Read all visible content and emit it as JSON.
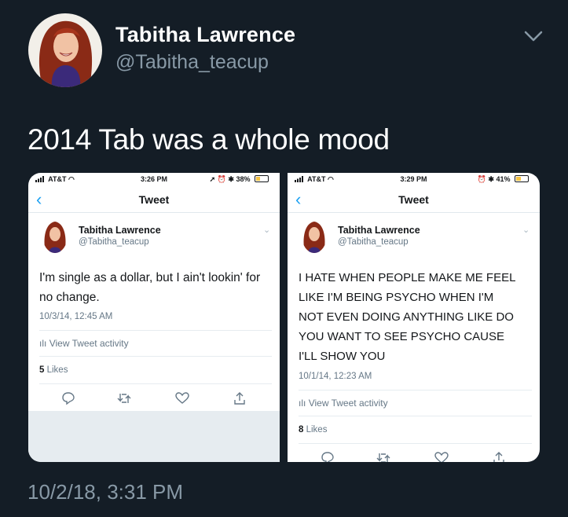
{
  "tweet": {
    "author_name": "Tabitha Lawrence",
    "author_handle": "@Tabitha_teacup",
    "text": "2014 Tab was a whole mood",
    "timestamp": "10/2/18, 3:31 PM",
    "menu_icon": "chevron-down-icon"
  },
  "screenshots": {
    "left": {
      "carrier": "AT&T",
      "time": "3:26 PM",
      "status_right": "38%",
      "battery_level": 0.38,
      "nav_title": "Tweet",
      "author_name": "Tabitha Lawrence",
      "author_handle": "@Tabitha_teacup",
      "text_line1": "I'm single as a dollar, but I ain't lookin' for",
      "text_line2": "no change.",
      "date": "10/3/14, 12:45 AM",
      "activity": "View Tweet activity",
      "likes_count": "5",
      "likes_label": "Likes"
    },
    "right": {
      "carrier": "AT&T",
      "time": "3:29 PM",
      "status_right": "41%",
      "battery_level": 0.41,
      "nav_title": "Tweet",
      "author_name": "Tabitha Lawrence",
      "author_handle": "@Tabitha_teacup",
      "text_line1": "I HATE WHEN PEOPLE MAKE ME FEEL",
      "text_line2": "LIKE I'M BEING PSYCHO WHEN I'M",
      "text_line3": "NOT EVEN DOING ANYTHING LIKE DO",
      "text_line4": "YOU WANT TO SEE PSYCHO CAUSE",
      "text_line5": "I'LL SHOW YOU",
      "date": "10/1/14, 12:23 AM",
      "activity": "View Tweet activity",
      "likes_count": "8",
      "likes_label": "Likes"
    }
  },
  "colors": {
    "background": "#141d26",
    "secondary_text": "#8899a6",
    "accent": "#1da1f2",
    "battery": "#f6c342"
  }
}
